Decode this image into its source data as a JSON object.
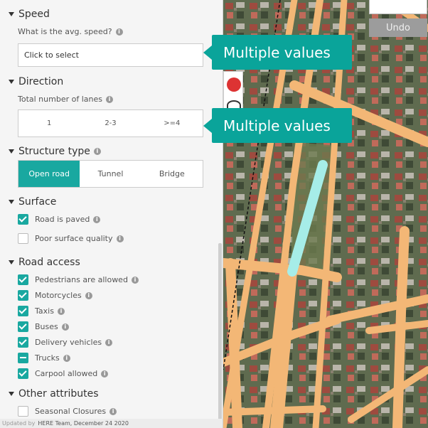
{
  "speed": {
    "title": "Speed",
    "question": "What is the avg. speed?",
    "placeholder": "Click to select"
  },
  "direction": {
    "title": "Direction",
    "lanes_label": "Total number of lanes",
    "lanes_options": [
      "1",
      "2-3",
      ">=4"
    ]
  },
  "structure": {
    "title": "Structure type",
    "options": [
      "Open road",
      "Tunnel",
      "Bridge"
    ],
    "selected": "Open road"
  },
  "surface": {
    "title": "Surface",
    "items": [
      {
        "label": "Road is paved",
        "state": "checked"
      },
      {
        "label": "Poor surface quality",
        "state": "unchecked"
      }
    ]
  },
  "road_access": {
    "title": "Road access",
    "items": [
      {
        "label": "Pedestrians are allowed",
        "state": "checked"
      },
      {
        "label": "Motorcycles",
        "state": "checked"
      },
      {
        "label": "Taxis",
        "state": "checked"
      },
      {
        "label": "Buses",
        "state": "checked"
      },
      {
        "label": "Delivery vehicles",
        "state": "checked"
      },
      {
        "label": "Trucks",
        "state": "indeterminate"
      },
      {
        "label": "Carpool allowed",
        "state": "checked"
      }
    ]
  },
  "other": {
    "title": "Other attributes",
    "items": [
      {
        "label": "Seasonal Closures",
        "state": "unchecked"
      }
    ]
  },
  "footer": {
    "prefix": "Updated by",
    "author": "HERE Team, December 24 2020"
  },
  "map": {
    "undo_label": "Undo"
  },
  "callouts": {
    "speed": "Multiple values",
    "lanes": "Multiple values"
  },
  "colors": {
    "accent": "#19a8a0",
    "callout": "#0aa49a",
    "road": "#f3b776",
    "selected_road": "#a6ede8"
  }
}
